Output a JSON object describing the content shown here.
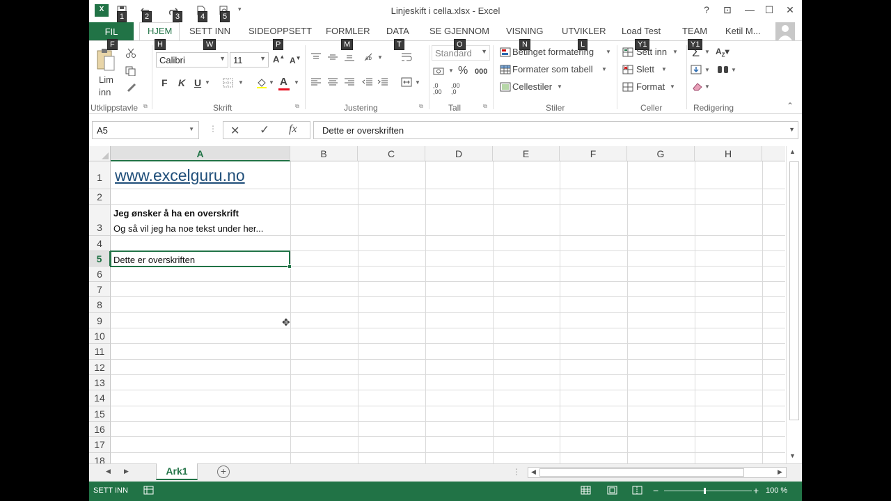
{
  "window": {
    "title": "Linjeskift i cella.xlsx - Excel",
    "help": "?",
    "ribbon_display": "⊡",
    "minimize": "—",
    "maximize": "☐",
    "close": "✕"
  },
  "qat_keytips": [
    "1",
    "2",
    "3",
    "4",
    "5"
  ],
  "tabs": {
    "fil": "FIL",
    "items": [
      "HJEM",
      "SETT INN",
      "SIDEOPPSETT",
      "FORMLER",
      "DATA",
      "SE GJENNOM",
      "VISNING",
      "UTVIKLER",
      "Load Test",
      "TEAM"
    ],
    "user": "Ketil M...",
    "keytips": [
      "F",
      "H",
      "W",
      "P",
      "M",
      "T",
      "O",
      "N",
      "L",
      "Y1",
      "Y2"
    ]
  },
  "ribbon": {
    "clipboard": {
      "paste_line1": "Lim",
      "paste_line2": "inn",
      "label": "Utklippstavle"
    },
    "font": {
      "name": "Calibri",
      "size": "11",
      "bold": "F",
      "italic": "K",
      "underline": "U",
      "label": "Skrift",
      "font_color": "#e81123"
    },
    "alignment": {
      "label": "Justering"
    },
    "number": {
      "format": "Standard",
      "percent": "%",
      "thousands": "000",
      "inc_dec": ",0\n,00",
      "dec_dec": ",00\n,0",
      "label": "Tall"
    },
    "styles": {
      "conditional": "Betinget formatering",
      "table": "Formater som tabell",
      "cell_styles": "Cellestiler",
      "label": "Stiler"
    },
    "cells": {
      "insert": "Sett inn",
      "delete": "Slett",
      "format": "Format",
      "label": "Celler"
    },
    "editing": {
      "label": "Redigering"
    }
  },
  "formula_bar": {
    "name_box": "A5",
    "fx": "fx",
    "content": "Dette er overskriften"
  },
  "grid": {
    "columns": [
      "A",
      "B",
      "C",
      "D",
      "E",
      "F",
      "G",
      "H"
    ],
    "rows": [
      "1",
      "2",
      "3",
      "4",
      "5",
      "6",
      "7",
      "8",
      "9",
      "10",
      "11",
      "12",
      "13",
      "14",
      "15",
      "16",
      "17",
      "18"
    ],
    "cells": {
      "A1": "www.excelguru.no",
      "A3_line1": "Jeg ønsker å ha en overskrift",
      "A3_line2": "Og så vil jeg ha noe tekst under her...",
      "A5": "Dette er overskriften"
    },
    "link_color": "#1f4e79"
  },
  "sheets": {
    "active": "Ark1"
  },
  "status": {
    "mode": "SETT INN",
    "zoom": "100 %"
  },
  "colors": {
    "accent": "#217346"
  }
}
